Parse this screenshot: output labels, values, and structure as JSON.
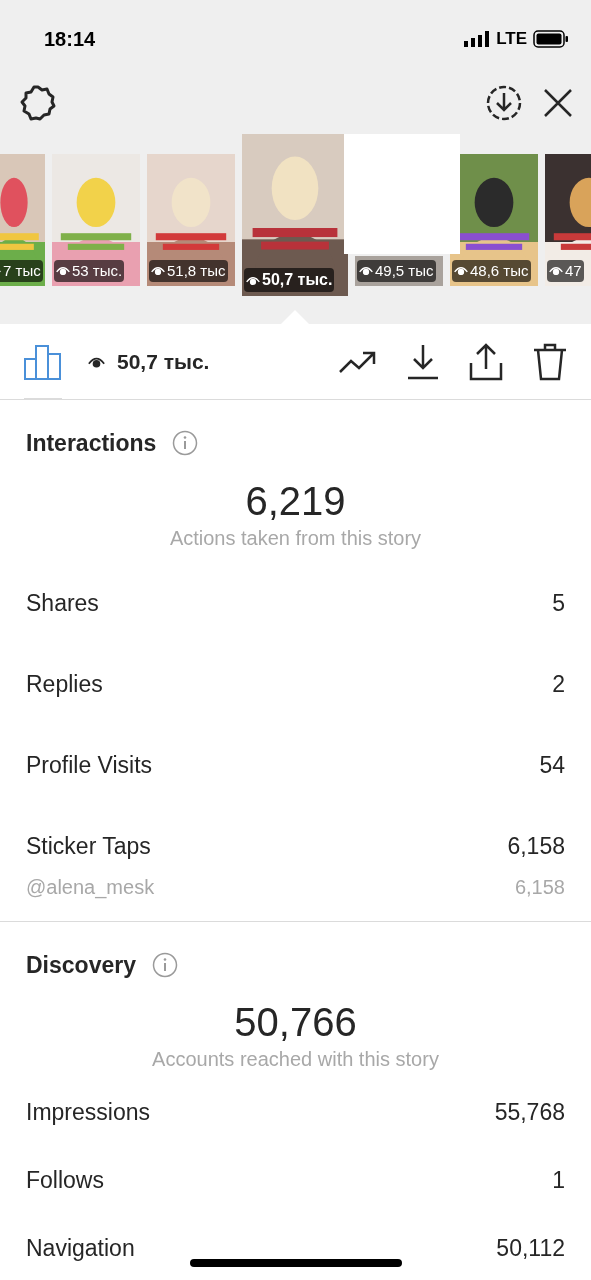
{
  "status_bar": {
    "time": "18:14",
    "network": "LTE"
  },
  "stories": [
    {
      "views": "7 тыс",
      "selected": false,
      "covered": false
    },
    {
      "views": "53 тыс.",
      "selected": false,
      "covered": false
    },
    {
      "views": "51,8 тыс",
      "selected": false,
      "covered": false
    },
    {
      "views": "50,7 тыс.",
      "selected": true,
      "covered": false
    },
    {
      "views": "49,5 тыс",
      "selected": false,
      "covered": true
    },
    {
      "views": "48,6 тыс",
      "selected": false,
      "covered": false
    },
    {
      "views": "47",
      "selected": false,
      "covered": false
    }
  ],
  "toolbar": {
    "views": "50,7 тыс."
  },
  "interactions": {
    "title": "Interactions",
    "total": "6,219",
    "caption": "Actions taken from this story",
    "rows": [
      {
        "label": "Shares",
        "value": "5",
        "kind": "main"
      },
      {
        "label": "Replies",
        "value": "2",
        "kind": "main"
      },
      {
        "label": "Profile Visits",
        "value": "54",
        "kind": "main"
      },
      {
        "label": "Sticker Taps",
        "value": "6,158",
        "kind": "main"
      },
      {
        "label": "@alena_mesk",
        "value": "6,158",
        "kind": "sub"
      }
    ]
  },
  "discovery": {
    "title": "Discovery",
    "total": "50,766",
    "caption": "Accounts reached with this story",
    "rows": [
      {
        "label": "Impressions",
        "value": "55,768"
      },
      {
        "label": "Follows",
        "value": "1"
      },
      {
        "label": "Navigation",
        "value": "50,112"
      }
    ]
  }
}
